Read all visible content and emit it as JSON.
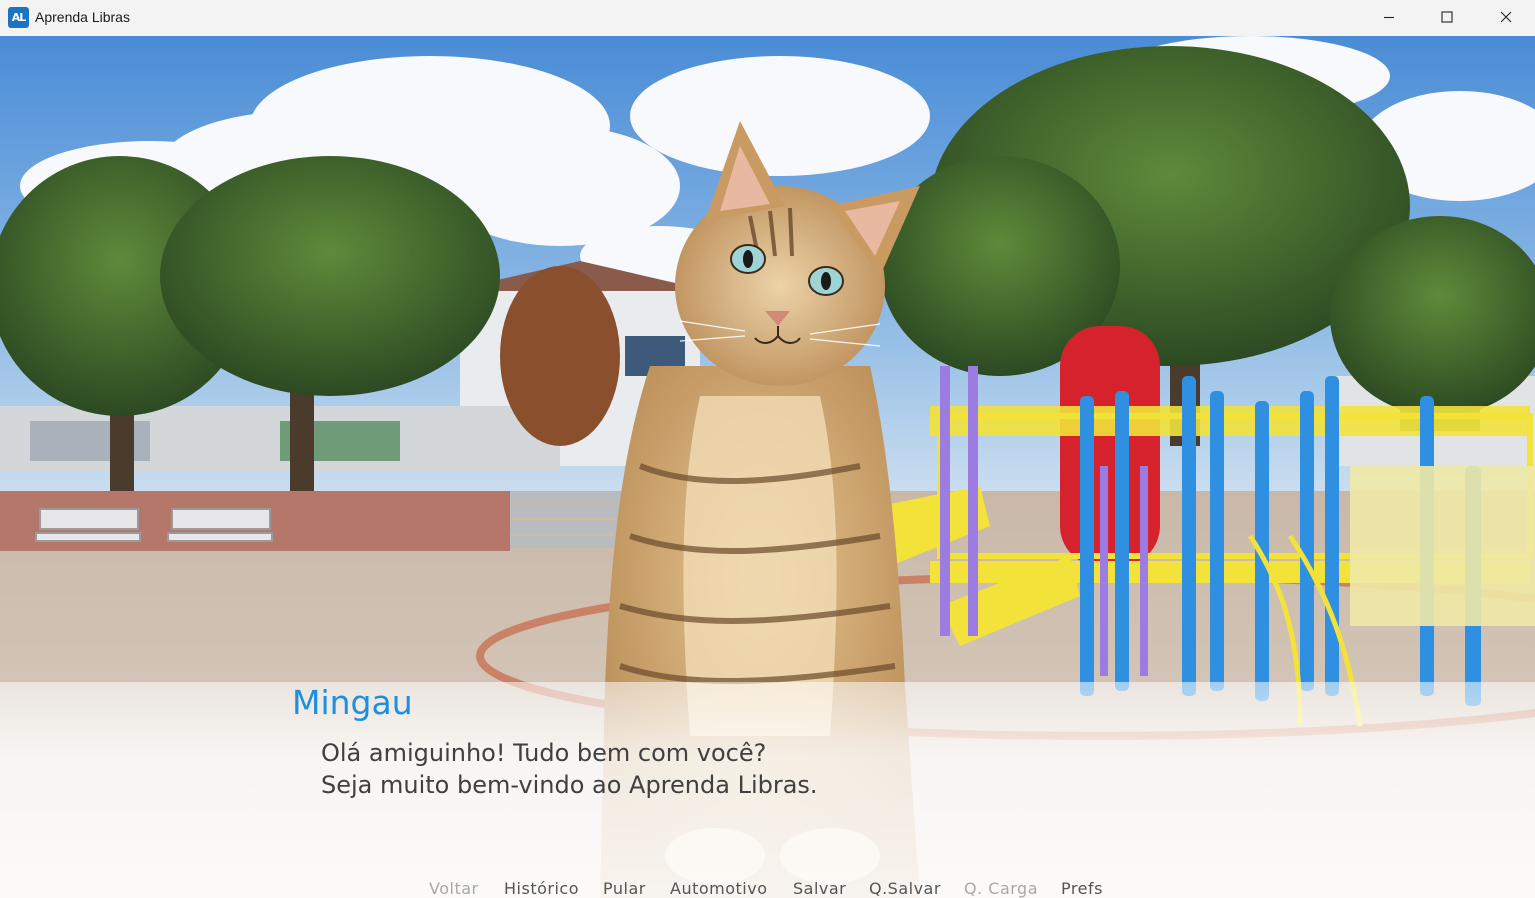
{
  "window": {
    "title": "Aprenda Libras",
    "icon_text": "AL",
    "icon": "app-logo-icon",
    "controls": [
      "minimize-icon",
      "maximize-icon",
      "close-icon"
    ]
  },
  "scene": {
    "background": "playground-park",
    "character": "tabby-cat"
  },
  "dialogue": {
    "speaker": "Mingau",
    "lines": [
      "Olá amiguinho! Tudo bem com você?",
      "Seja muito bem-vindo ao Aprenda Libras."
    ]
  },
  "quick_menu": {
    "items": [
      {
        "label": "Voltar",
        "enabled": false
      },
      {
        "label": "Histórico",
        "enabled": true
      },
      {
        "label": "Pular",
        "enabled": true
      },
      {
        "label": "Automotivo",
        "enabled": true
      },
      {
        "label": "Salvar",
        "enabled": true
      },
      {
        "label": "Q.Salvar",
        "enabled": true
      },
      {
        "label": "Q. Carga",
        "enabled": false
      },
      {
        "label": "Prefs",
        "enabled": true
      }
    ]
  },
  "colors": {
    "speaker": "#1c8fe0",
    "text": "#404040",
    "menu_enabled": "#555555",
    "menu_disabled": "#a8a8a8"
  }
}
